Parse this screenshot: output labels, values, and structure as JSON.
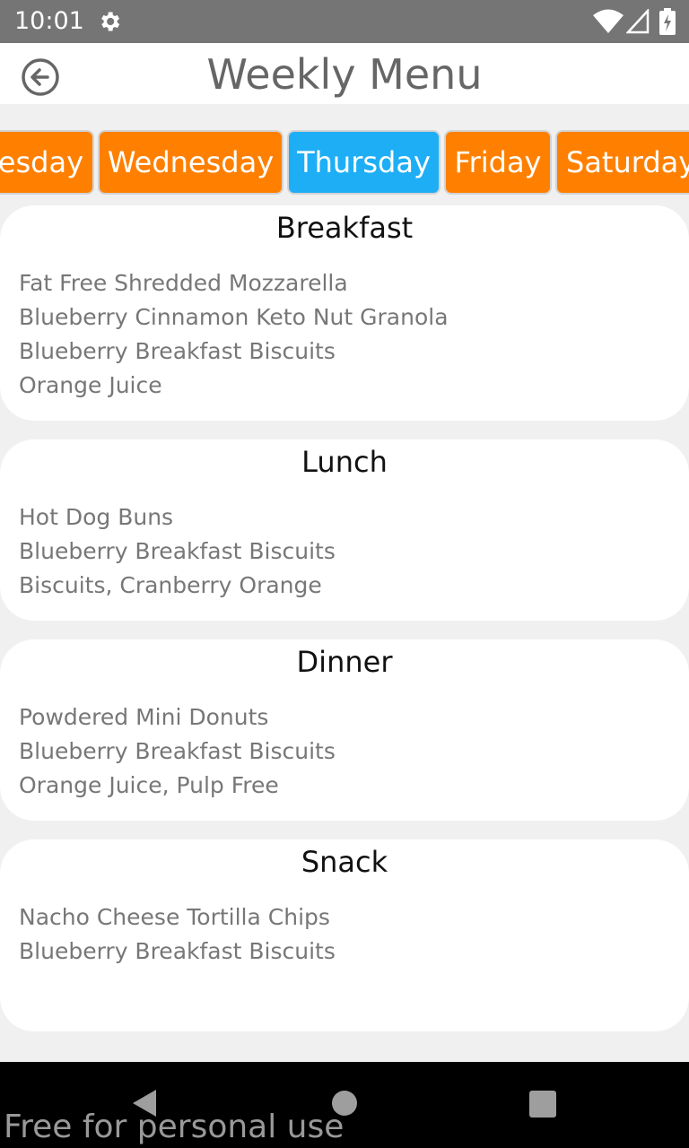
{
  "status_bar": {
    "time": "10:01",
    "icons": [
      "gear-icon",
      "wifi-icon",
      "signal-icon",
      "battery-icon"
    ]
  },
  "header": {
    "title": "Weekly Menu",
    "back_icon": "back-arrow-circle-icon"
  },
  "tabs": [
    {
      "label": "esday",
      "active": false
    },
    {
      "label": "Wednesday",
      "active": false
    },
    {
      "label": "Thursday",
      "active": true
    },
    {
      "label": "Friday",
      "active": false
    },
    {
      "label": "Saturday",
      "active": false
    }
  ],
  "meals": {
    "breakfast": {
      "title": "Breakfast",
      "items": [
        "Fat Free Shredded Mozzarella",
        "Blueberry Cinnamon Keto Nut Granola",
        "Blueberry Breakfast Biscuits",
        "Orange Juice"
      ]
    },
    "lunch": {
      "title": "Lunch",
      "items": [
        "Hot Dog Buns",
        "Blueberry Breakfast Biscuits",
        "Biscuits, Cranberry Orange"
      ]
    },
    "dinner": {
      "title": "Dinner",
      "items": [
        "Powdered Mini Donuts",
        "Blueberry Breakfast Biscuits",
        "Orange Juice, Pulp Free"
      ]
    },
    "snack": {
      "title": "Snack",
      "items": [
        "Nacho Cheese Tortilla Chips",
        "Blueberry Breakfast Biscuits"
      ]
    }
  },
  "watermark": "Free for personal use",
  "colors": {
    "tab": "#ff8000",
    "tab_active": "#1eaef5",
    "status_bar": "#757575"
  }
}
